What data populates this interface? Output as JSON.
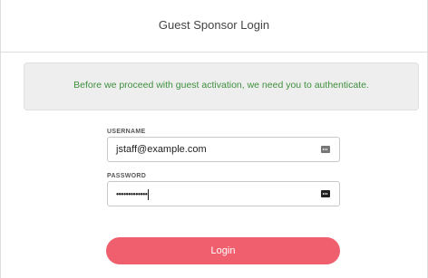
{
  "header": {
    "title": "Guest Sponsor Login"
  },
  "notice": {
    "text": "Before we proceed with guest activation, we need you to authenticate."
  },
  "form": {
    "username": {
      "label": "USERNAME",
      "value": "jstaff@example.com",
      "icon": "password-manager-key-icon"
    },
    "password": {
      "label": "PASSWORD",
      "masked_value": "•••••••••••••",
      "icon": "password-manager-key-icon"
    },
    "login_label": "Login"
  },
  "colors": {
    "notice_text": "#3f8f3f",
    "notice_bg": "#eeeeee",
    "button_bg": "#ef5f6d"
  }
}
